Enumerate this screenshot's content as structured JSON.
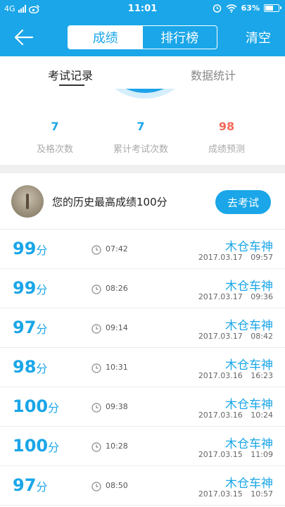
{
  "status_bar": {
    "network": "4G",
    "time": "11:01",
    "battery": "63%",
    "battery_level": 0.63
  },
  "nav": {
    "back_icon": "arrow-left-icon",
    "tabs": [
      {
        "label": "成绩",
        "active": true
      },
      {
        "label": "排行榜",
        "active": false
      }
    ],
    "clear_label": "清空"
  },
  "subtabs": [
    {
      "label": "考试记录",
      "active": true
    },
    {
      "label": "数据统计",
      "active": false
    }
  ],
  "stats": [
    {
      "value": "7",
      "label": "及格次数",
      "color": "#1aa6e8"
    },
    {
      "value": "7",
      "label": "累计考试次数",
      "color": "#1aa6e8"
    },
    {
      "value": "98",
      "label": "成绩预测",
      "color": "#f26b5b"
    }
  ],
  "best": {
    "text": "您的历史最高成绩100分",
    "button": "去考试"
  },
  "records": [
    {
      "score": "99",
      "unit": "分",
      "duration": "07:42",
      "name": "木仓车神",
      "date": "2017.03.17 09:57"
    },
    {
      "score": "99",
      "unit": "分",
      "duration": "08:26",
      "name": "木仓车神",
      "date": "2017.03.17 09:36"
    },
    {
      "score": "97",
      "unit": "分",
      "duration": "09:14",
      "name": "木仓车神",
      "date": "2017.03.17 08:42"
    },
    {
      "score": "98",
      "unit": "分",
      "duration": "10:31",
      "name": "木仓车神",
      "date": "2017.03.16 16:23"
    },
    {
      "score": "100",
      "unit": "分",
      "duration": "09:38",
      "name": "木仓车神",
      "date": "2017.03.16 10:24"
    },
    {
      "score": "100",
      "unit": "分",
      "duration": "10:28",
      "name": "木仓车神",
      "date": "2017.03.15 11:09"
    },
    {
      "score": "97",
      "unit": "分",
      "duration": "08:50",
      "name": "木仓车神",
      "date": "2017.03.15 10:57"
    }
  ],
  "colors": {
    "accent": "#1aa6e8",
    "prediction": "#f26b5b"
  }
}
